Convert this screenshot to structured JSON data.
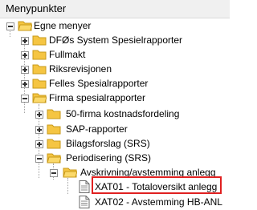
{
  "panel": {
    "title": "Menypunkter"
  },
  "tree": [
    {
      "label": "Egne menyer",
      "state": "expanded",
      "icon": "folder-open-icon"
    },
    {
      "label": "DFØs System Spesielrapporter",
      "state": "collapsed",
      "icon": "folder-icon"
    },
    {
      "label": "Fullmakt",
      "state": "collapsed",
      "icon": "folder-icon"
    },
    {
      "label": "Riksrevisjonen",
      "state": "collapsed",
      "icon": "folder-icon"
    },
    {
      "label": "Felles Spesialrapporter",
      "state": "collapsed",
      "icon": "folder-icon"
    },
    {
      "label": "Firma spesialrapporter",
      "state": "expanded",
      "icon": "folder-open-icon"
    },
    {
      "label": "50-firma kostnadsfordeling",
      "state": "collapsed",
      "icon": "folder-icon"
    },
    {
      "label": "SAP-rapporter",
      "state": "collapsed",
      "icon": "folder-icon"
    },
    {
      "label": "Bilagsforslag (SRS)",
      "state": "collapsed",
      "icon": "folder-icon"
    },
    {
      "label": "Periodisering (SRS)",
      "state": "expanded",
      "icon": "folder-open-icon"
    },
    {
      "label": "Avskrivning/avstemming anlegg",
      "state": "expanded",
      "icon": "folder-open-icon"
    },
    {
      "label": "XAT01 - Totaloversikt anlegg",
      "state": "leaf",
      "icon": "document-icon",
      "highlighted": true
    },
    {
      "label": "XAT02 - Avstemming HB-ANL",
      "state": "leaf",
      "icon": "document-icon"
    }
  ],
  "colors": {
    "folder": "#f5c542",
    "folder_dark": "#d9a520",
    "highlight_border": "#e02020",
    "header_bg": "#f0f0f0"
  }
}
